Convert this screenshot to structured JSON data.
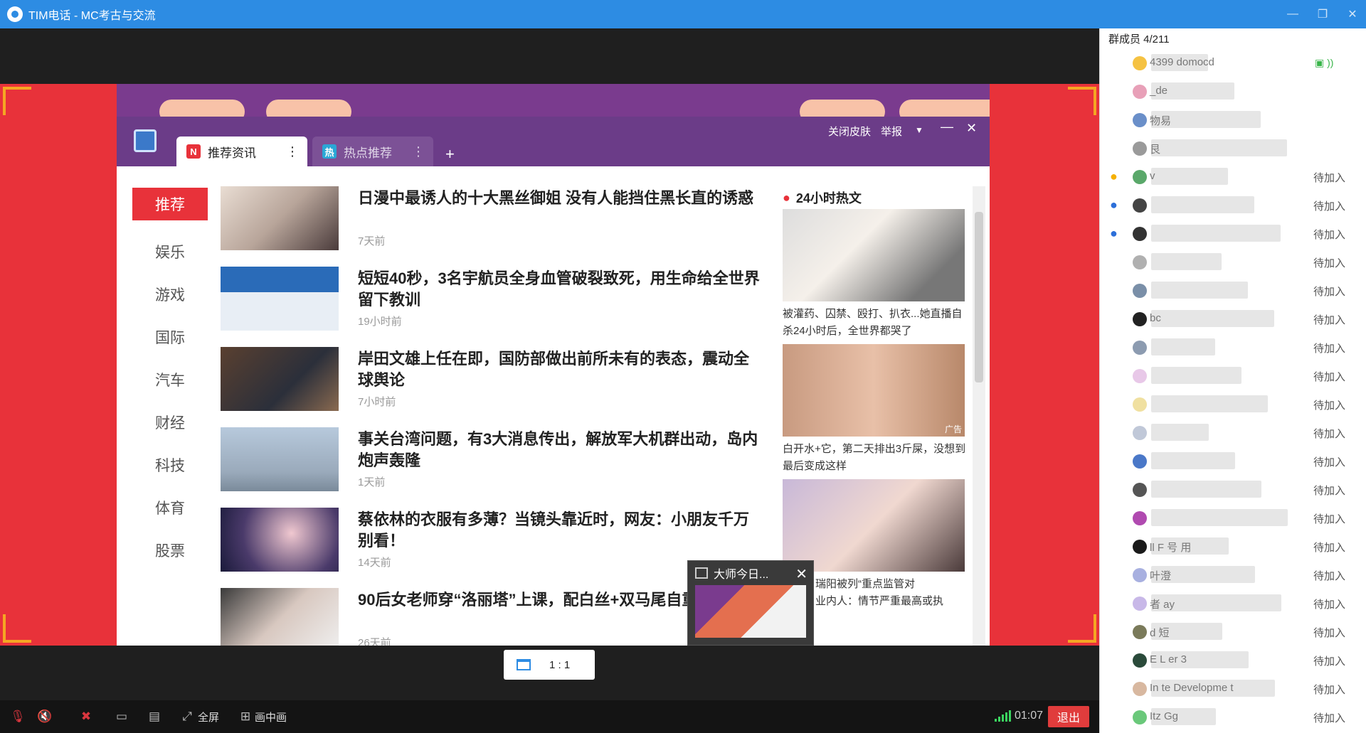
{
  "window": {
    "title": "TIM电话 - MC考古与交流",
    "controls": [
      "—",
      "❐",
      "✕"
    ]
  },
  "news": {
    "tabs": [
      {
        "badge": "N",
        "label": "推荐资讯",
        "badge_color": "#e8323a"
      },
      {
        "badge": "热",
        "label": "热点推荐",
        "badge_color": "#2aa7d6"
      }
    ],
    "top_controls": {
      "close_skin": "关闭皮肤",
      "report": "举报"
    },
    "categories": [
      "推荐",
      "娱乐",
      "游戏",
      "国际",
      "汽车",
      "财经",
      "科技",
      "体育",
      "股票"
    ],
    "articles": [
      {
        "title": "日漫中最诱人的十大黑丝御姐 没有人能挡住黑长直的诱惑",
        "time": "7天前"
      },
      {
        "title": "短短40秒，3名宇航员全身血管破裂致死，用生命给全世界留下教训",
        "time": "19小时前"
      },
      {
        "title": "岸田文雄上任在即，国防部做出前所未有的表态，震动全球舆论",
        "time": "7小时前"
      },
      {
        "title": "事关台湾问题，有3大消息传出，解放军大机群出动，岛内炮声轰隆",
        "time": "1天前"
      },
      {
        "title": "蔡依林的衣服有多薄？当镜头靠近时，网友：小朋友千万别看！",
        "time": "14天前"
      },
      {
        "title": "90后女老师穿“洛丽塔”上课，配白丝+双马尾自重",
        "time": "26天前"
      }
    ],
    "hot": {
      "title": "24小时热文",
      "captions": [
        "被灌药、囚禁、殴打、扒衣...她直播自杀24小时后，全世界都哭了",
        "白开水+它，第二天排出3斤屎，没想到最后变成这样",
        "瑞阳被列“重点监管对",
        "业内人：情节严重最高或执"
      ],
      "ad_label": "广告"
    },
    "popup": {
      "title": "大师今日..."
    }
  },
  "ratio_button": {
    "label": "1 : 1"
  },
  "toolbar": {
    "fullscreen": "全屏",
    "pip": "画中画",
    "timer": "01:07",
    "exit": "退出"
  },
  "members": {
    "header": "群成员 4/211",
    "list": [
      {
        "role": "",
        "name": "4399",
        "name2": "domocd",
        "status": "",
        "live": true,
        "avatar": "#f5c242"
      },
      {
        "role": "",
        "name": "_de",
        "name2": "",
        "status": "",
        "live": false,
        "avatar": "#e8a0b8"
      },
      {
        "role": "",
        "name": "物易",
        "name2": "",
        "status": "",
        "live": false,
        "avatar": "#6a8fc9"
      },
      {
        "role": "",
        "name": "艮",
        "name2": "",
        "status": "",
        "live": false,
        "avatar": "#9a9a9a"
      },
      {
        "role": "gold",
        "name": "v",
        "name2": "",
        "status": "待加入",
        "live": false,
        "avatar": "#5aa86a"
      },
      {
        "role": "blue",
        "name": "",
        "name2": "",
        "status": "待加入",
        "live": false,
        "avatar": "#444444"
      },
      {
        "role": "blue",
        "name": "",
        "name2": "",
        "status": "待加入",
        "live": false,
        "avatar": "#333333"
      },
      {
        "role": "",
        "name": "",
        "name2": "",
        "status": "待加入",
        "live": false,
        "avatar": "#b0b0b0"
      },
      {
        "role": "",
        "name": "",
        "name2": "",
        "status": "待加入",
        "live": false,
        "avatar": "#7a8fa8"
      },
      {
        "role": "",
        "name": "bc",
        "name2": "",
        "status": "待加入",
        "live": false,
        "avatar": "#222222"
      },
      {
        "role": "",
        "name": "",
        "name2": "",
        "status": "待加入",
        "live": false,
        "avatar": "#8c9bb0"
      },
      {
        "role": "",
        "name": "",
        "name2": "",
        "status": "待加入",
        "live": false,
        "avatar": "#e8c8e8"
      },
      {
        "role": "",
        "name": "",
        "name2": "",
        "status": "待加入",
        "live": false,
        "avatar": "#f0e0a0"
      },
      {
        "role": "",
        "name": "",
        "name2": "",
        "status": "待加入",
        "live": false,
        "avatar": "#c0c8d8"
      },
      {
        "role": "",
        "name": "",
        "name2": "",
        "status": "待加入",
        "live": false,
        "avatar": "#4a78c8"
      },
      {
        "role": "",
        "name": "",
        "name2": "",
        "status": "待加入",
        "live": false,
        "avatar": "#555555"
      },
      {
        "role": "",
        "name": "",
        "name2": "",
        "status": "待加入",
        "live": false,
        "avatar": "#b04ab0"
      },
      {
        "role": "",
        "name": "ll F",
        "name2": "号 用",
        "status": "待加入",
        "live": false,
        "avatar": "#1a1a1a"
      },
      {
        "role": "",
        "name": "叶澄",
        "name2": "",
        "status": "待加入",
        "live": false,
        "avatar": "#a8b0e0"
      },
      {
        "role": "",
        "name": "者",
        "name2": "ay",
        "status": "待加入",
        "live": false,
        "avatar": "#c8b8e8"
      },
      {
        "role": "",
        "name": "d 短",
        "name2": "",
        "status": "待加入",
        "live": false,
        "avatar": "#7a7a5a"
      },
      {
        "role": "",
        "name": "E L er 3",
        "name2": "",
        "status": "待加入",
        "live": false,
        "avatar": "#2a4a3a"
      },
      {
        "role": "",
        "name": "In te Developme t",
        "name2": "",
        "status": "待加入",
        "live": false,
        "avatar": "#d8b8a0"
      },
      {
        "role": "",
        "name": "Itz Gg",
        "name2": "",
        "status": "待加入",
        "live": false,
        "avatar": "#6ac87a"
      }
    ]
  }
}
